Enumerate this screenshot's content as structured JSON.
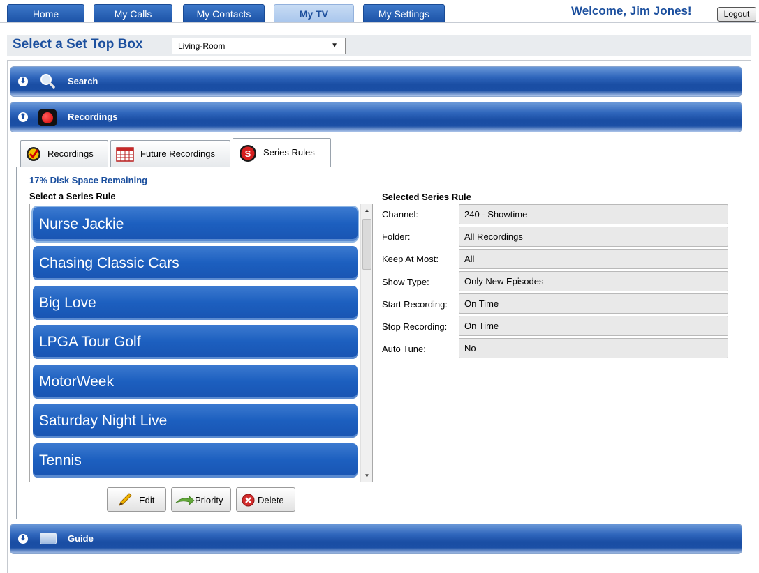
{
  "nav": {
    "tabs": [
      "Home",
      "My Calls",
      "My Contacts",
      "My TV",
      "My Settings"
    ],
    "active_tab": "My TV",
    "welcome": "Welcome, Jim Jones!",
    "logout": "Logout"
  },
  "set_top_box": {
    "title": "Select a Set Top Box",
    "selected": "Living-Room"
  },
  "sections": {
    "search": "Search",
    "recordings": "Recordings",
    "guide": "Guide"
  },
  "subtabs": [
    "Recordings",
    "Future Recordings",
    "Series Rules"
  ],
  "active_subtab": "Series Rules",
  "disk_space": "17% Disk Space Remaining",
  "series_list": {
    "label": "Select a Series Rule",
    "items": [
      "Nurse Jackie",
      "Chasing Classic Cars",
      "Big Love",
      "LPGA Tour Golf",
      "MotorWeek",
      "Saturday Night Live",
      "Tennis"
    ],
    "selected": "Nurse Jackie"
  },
  "buttons": {
    "edit": "Edit",
    "priority": "Priority",
    "delete": "Delete"
  },
  "selected_rule": {
    "title": "Selected Series Rule",
    "fields": [
      {
        "label": "Channel:",
        "value": "240 - Showtime"
      },
      {
        "label": "Folder:",
        "value": "All Recordings"
      },
      {
        "label": "Keep At Most:",
        "value": "All"
      },
      {
        "label": "Show Type:",
        "value": "Only New Episodes"
      },
      {
        "label": "Start Recording:",
        "value": "On Time"
      },
      {
        "label": "Stop Recording:",
        "value": "On Time"
      },
      {
        "label": "Auto Tune:",
        "value": "No"
      }
    ]
  },
  "colors": {
    "brand_blue": "#1b4f9e",
    "list_item": "#1c5fbf"
  },
  "icons": [
    "chevron-down-icon",
    "chevron-up-icon",
    "magnifier-icon",
    "record-icon",
    "guide-icon",
    "checkmark-icon",
    "calendar-icon",
    "series-icon",
    "pencil-icon",
    "arrow-icon",
    "delete-icon",
    "scroll-up-icon",
    "scroll-down-icon",
    "dropdown-arrow-icon"
  ]
}
